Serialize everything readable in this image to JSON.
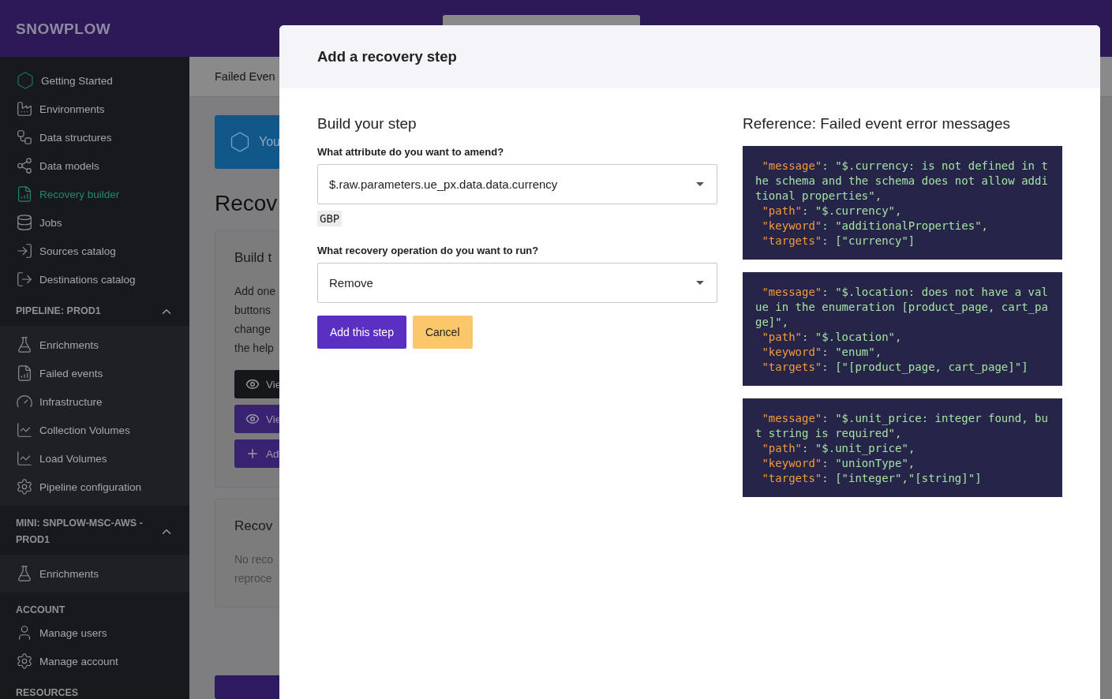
{
  "header": {
    "logo": "SNOWPLOW"
  },
  "sidebar": {
    "sections": [
      {
        "kind": "plain",
        "items": [
          {
            "label": "Getting Started",
            "selected": false
          },
          {
            "label": "Environments",
            "selected": false
          },
          {
            "label": "Data structures",
            "selected": false
          },
          {
            "label": "Data models",
            "selected": false
          },
          {
            "label": "Recovery builder",
            "selected": true
          },
          {
            "label": "Jobs",
            "selected": false
          },
          {
            "label": "Sources catalog",
            "selected": false
          },
          {
            "label": "Destinations catalog",
            "selected": false
          }
        ]
      },
      {
        "kind": "collapsible",
        "title": "PIPELINE: PROD1",
        "expanded": true,
        "items": [
          {
            "label": "Enrichments",
            "selected": false
          },
          {
            "label": "Failed events",
            "selected": false
          },
          {
            "label": "Infrastructure",
            "selected": false
          },
          {
            "label": "Collection Volumes",
            "selected": false
          },
          {
            "label": "Load Volumes",
            "selected": false
          },
          {
            "label": "Pipeline configuration",
            "selected": false
          }
        ]
      },
      {
        "kind": "collapsible",
        "title": "MINI: SNPLOW-MSC-AWS -PROD1",
        "expanded": true,
        "items": [
          {
            "label": "Enrichments",
            "selected": false
          }
        ]
      },
      {
        "kind": "plain",
        "title": "ACCOUNT",
        "items": [
          {
            "label": "Manage users",
            "selected": false
          },
          {
            "label": "Manage account",
            "selected": false
          }
        ]
      },
      {
        "kind": "plain",
        "title": "RESOURCES"
      }
    ]
  },
  "main": {
    "breadcrumb": "Failed Even",
    "banner": "You",
    "heading": "Recov",
    "card": {
      "title": "Build t",
      "lines": [
        "Add one",
        "buttons",
        "change",
        "the help"
      ],
      "buttons": [
        {
          "label": "Vie",
          "kind": "view-dark"
        },
        {
          "label": "Vie",
          "kind": "view"
        },
        {
          "label": "Ad",
          "kind": "add"
        }
      ]
    },
    "card2": {
      "title": "Recov",
      "lines": [
        "No reco",
        "reproce"
      ]
    }
  },
  "modal": {
    "title": "Add a recovery step",
    "build": {
      "heading": "Build your step",
      "attribute": {
        "label": "What attribute do you want to amend?",
        "value": "$.raw.parameters.ue_px.data.data.currency",
        "hint": "GBP"
      },
      "operation": {
        "label": "What recovery operation do you want to run?",
        "value": "Remove"
      },
      "buttons": [
        {
          "label": "Add this step",
          "kind": "primary"
        },
        {
          "label": "Cancel",
          "kind": "warning"
        }
      ]
    },
    "reference": {
      "heading": "Reference: Failed event error messages",
      "blocks": [
        {
          "lines": [
            {
              "key": " \"message\"",
              "rest": ": \"$.currency: is not defined in the schema and the schema does not allow additional properties\","
            },
            {
              "key": " \"path\"",
              "rest": ": \"$.currency\","
            },
            {
              "key": " \"keyword\"",
              "rest": ": \"additionalProperties\","
            },
            {
              "key": " \"targets\"",
              "rest": ": [\"currency\"]"
            }
          ]
        },
        {
          "lines": [
            {
              "key": " \"message\"",
              "rest": ": \"$.location: does not have a value in the enumeration [product_page, cart_page]\","
            },
            {
              "key": " \"path\"",
              "rest": ": \"$.location\","
            },
            {
              "key": " \"keyword\"",
              "rest": ": \"enum\","
            },
            {
              "key": " \"targets\"",
              "rest": ": [\"[product_page, cart_page]\"]"
            }
          ]
        },
        {
          "lines": [
            {
              "key": " \"message\"",
              "rest": ": \"$.unit_price: integer found, but string is required\","
            },
            {
              "key": " \"path\"",
              "rest": ": \"$.unit_price\","
            },
            {
              "key": " \"keyword\"",
              "rest": ": \"unionType\","
            },
            {
              "key": " \"targets\"",
              "rest": ": [\"integer\",\"[string]\"]"
            }
          ]
        }
      ]
    }
  }
}
